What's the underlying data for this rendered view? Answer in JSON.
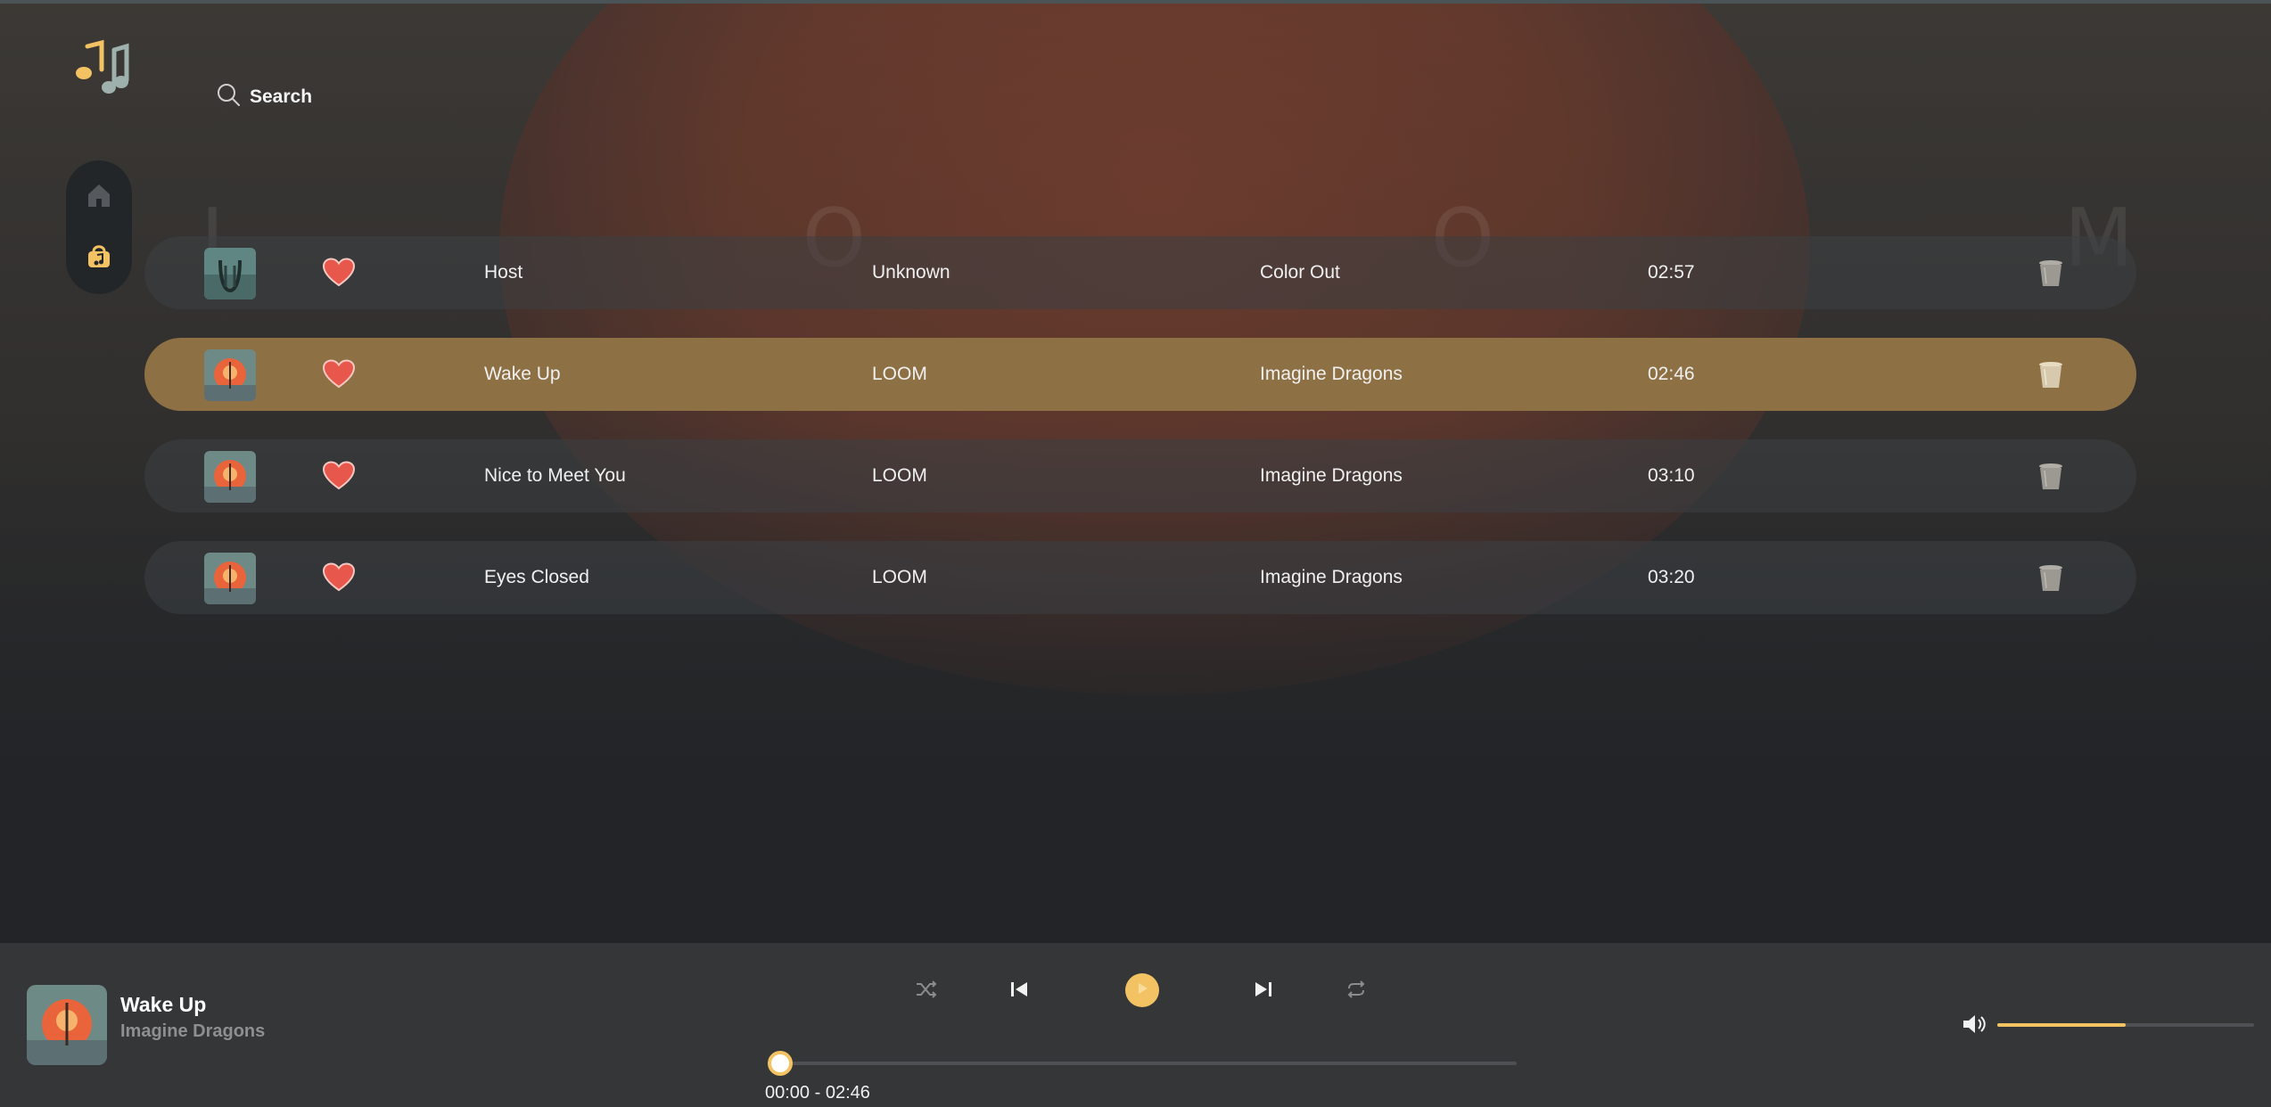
{
  "app": {
    "logo_icon": "music-notes-icon"
  },
  "search": {
    "label": "Search",
    "icon": "search-icon"
  },
  "nav": {
    "items": [
      {
        "icon": "home-icon",
        "active": false
      },
      {
        "icon": "music-bag-icon",
        "active": true
      }
    ]
  },
  "tracks": [
    {
      "title": "Host",
      "album": "Unknown",
      "artist": "Color Out",
      "duration": "02:57",
      "liked": true,
      "active": false
    },
    {
      "title": "Wake Up",
      "album": "LOOM",
      "artist": "Imagine Dragons",
      "duration": "02:46",
      "liked": true,
      "active": true
    },
    {
      "title": "Nice to Meet You",
      "album": "LOOM",
      "artist": "Imagine Dragons",
      "duration": "03:10",
      "liked": true,
      "active": false
    },
    {
      "title": "Eyes Closed",
      "album": "LOOM",
      "artist": "Imagine Dragons",
      "duration": "03:20",
      "liked": true,
      "active": false
    }
  ],
  "player": {
    "title": "Wake Up",
    "artist": "Imagine Dragons",
    "time_readout": "00:00 - 02:46",
    "progress": 0.0,
    "volume": 0.5
  },
  "colors": {
    "accent": "#f3c363",
    "active_row": "#8e7045",
    "heart": "#e8574b"
  }
}
